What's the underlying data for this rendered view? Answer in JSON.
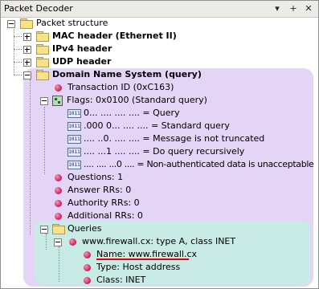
{
  "window": {
    "title": "Packet Decoder",
    "buttons": [
      "▾",
      "+",
      "✕"
    ]
  },
  "tree": {
    "root": "Packet structure",
    "mac": "MAC header (Ethernet II)",
    "ipv4": "IPv4 header",
    "udp": "UDP header",
    "dns": "Domain Name System (query)",
    "transaction_id": "Transaction ID (0xC163)",
    "flags": "Flags: 0x0100 (Standard query)",
    "flag_bits": [
      "0... .... .... .... = Query",
      ".000 0... .... .... = Standard query",
      ".... ..0. .... .... = Message is not truncated",
      ".... ...1 .... .... = Do query recursively",
      ".... .... ...0 .... = Non-authenticated data is unacceptable"
    ],
    "bits_icon_text": "1011",
    "questions": "Questions: 1",
    "answer_rrs": "Answer RRs: 0",
    "authority_rrs": "Authority RRs: 0",
    "additional_rrs": "Additional RRs: 0",
    "queries": "Queries",
    "query_entry": "www.firewall.cx: type A, class INET",
    "name": "Name: www.firewall.cx",
    "type": "Type: Host address",
    "class": "Class: INET"
  }
}
